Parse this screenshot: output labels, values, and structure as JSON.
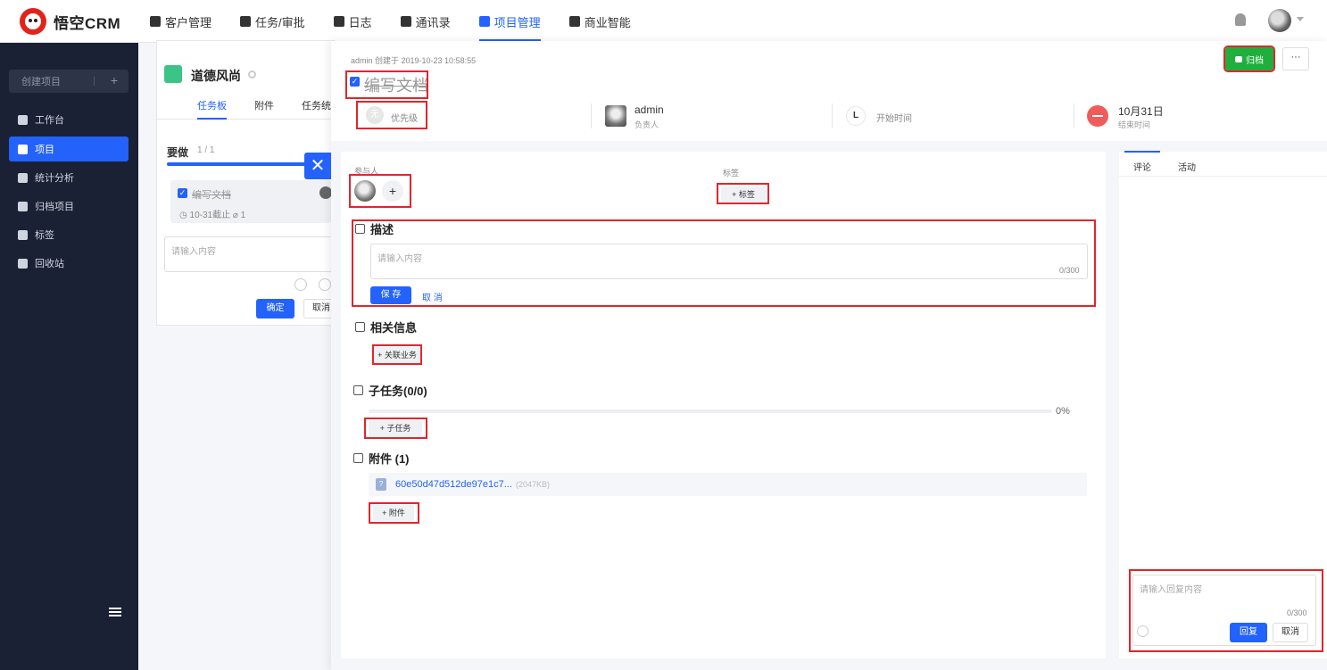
{
  "app": {
    "logo_text": "悟空CRM"
  },
  "nav": {
    "items": [
      {
        "label": "客户管理",
        "icon": "building-icon"
      },
      {
        "label": "任务/审批",
        "icon": "briefcase-icon"
      },
      {
        "label": "日志",
        "icon": "log-icon"
      },
      {
        "label": "通讯录",
        "icon": "contacts-icon"
      },
      {
        "label": "项目管理",
        "icon": "project-icon",
        "active": true
      },
      {
        "label": "商业智能",
        "icon": "bi-icon"
      }
    ]
  },
  "sidebar": {
    "create_label": "创建项目",
    "create_plus": "+",
    "items": [
      {
        "label": "工作台",
        "icon": "monitor-icon"
      },
      {
        "label": "项目",
        "icon": "project-icon",
        "active": true
      },
      {
        "label": "统计分析",
        "icon": "bar-chart-icon"
      },
      {
        "label": "归档项目",
        "icon": "archive-icon"
      },
      {
        "label": "标签",
        "icon": "tag-icon"
      },
      {
        "label": "回收站",
        "icon": "trash-icon"
      }
    ]
  },
  "project": {
    "title": "道德风尚",
    "tabs": [
      "任务板",
      "附件",
      "任务统计"
    ],
    "list_title": "要做",
    "list_count": "1 / 1",
    "task_card_name": "编写文档",
    "task_card_meta": "◷ 10-31截止  ⌀ 1",
    "quick_placeholder": "请输入内容",
    "ok_label": "确定",
    "cancel_label": "取消"
  },
  "detail": {
    "close": "✕",
    "created": "admin 创建于 2019-10-23 10:58:55",
    "archive_label": "归档",
    "more_label": "···",
    "title": "编写文档",
    "priority_char": "无",
    "priority_label": "优先级",
    "owner_name": "admin",
    "owner_role": "负责人",
    "start_char": "L",
    "start_label": "开始时间",
    "end_date": "10月31日",
    "end_label": "结束时间",
    "participants_label": "参与人",
    "participant_add": "+",
    "tags_label": "标签",
    "tag_add": "+ 标签",
    "desc_title": "描述",
    "desc_placeholder": "请输入内容",
    "desc_count": "0/300",
    "save_label": "保 存",
    "cancel_label": "取 消",
    "related_title": "相关信息",
    "related_add": "+ 关联业务",
    "subtask_title": "子任务(0/0)",
    "subtask_progress": 0,
    "subtask_pct": "0%",
    "subtask_add": "+ 子任务",
    "attach_title": "附件 (1)",
    "file_name": "60e50d47d512de97e1c7...",
    "file_size": "(2047KB)",
    "attach_add": "+ 附件"
  },
  "comments": {
    "tabs": [
      "评论",
      "活动"
    ],
    "reply_placeholder": "请输入回复内容",
    "reply_count": "0/300",
    "reply_label": "回复",
    "cancel_label": "取消"
  },
  "colors": {
    "primary": "#2362fb",
    "archive": "#1faf3c",
    "highlight": "#e0262c",
    "end_date": "#f15b5b",
    "sidebar": "#1b2134"
  }
}
